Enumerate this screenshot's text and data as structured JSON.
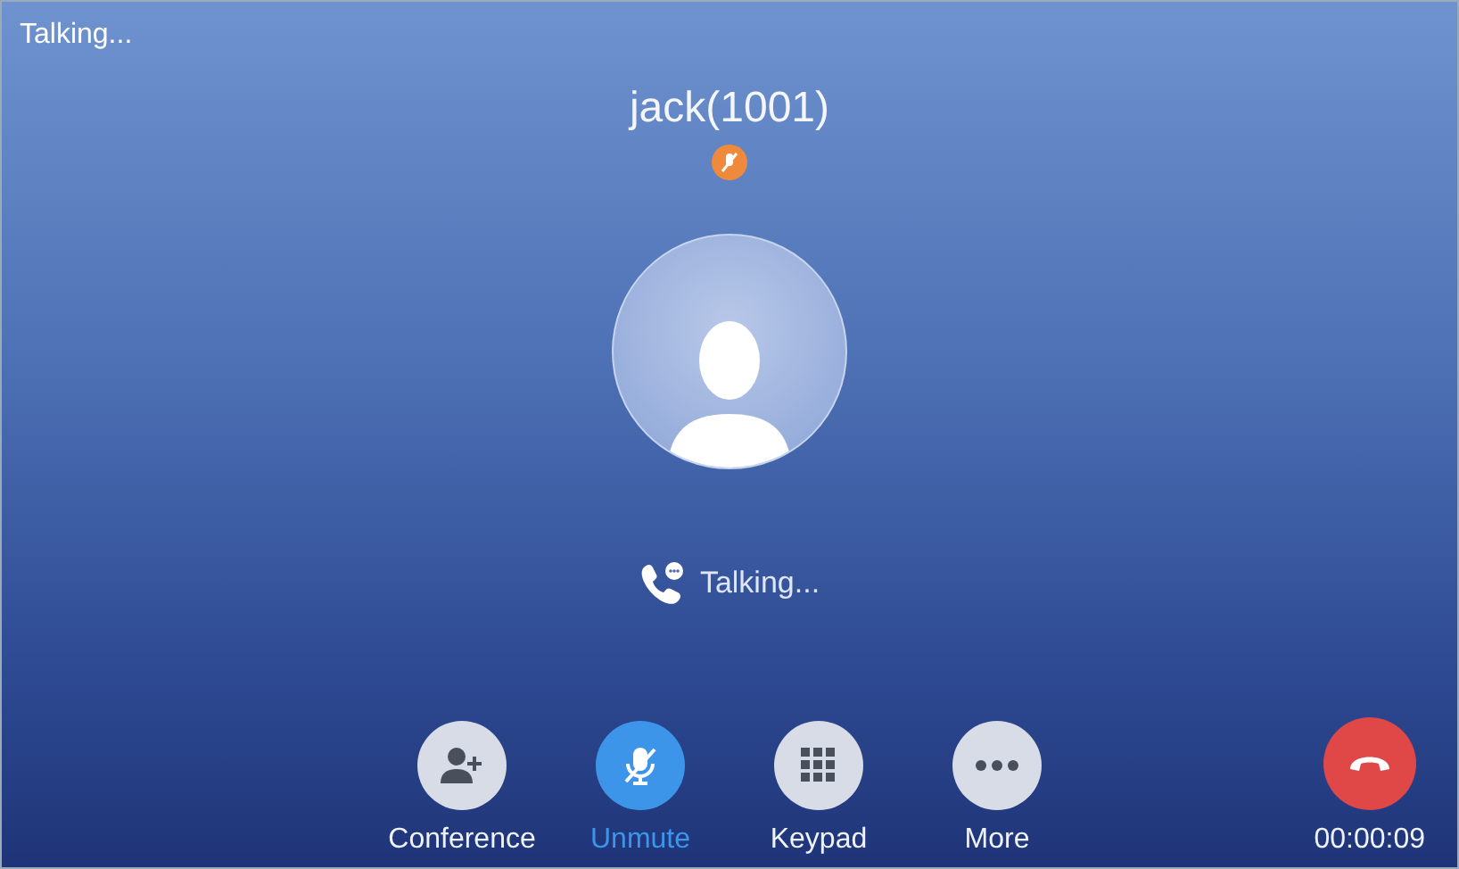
{
  "status_bar": {
    "text": "Talking..."
  },
  "caller": {
    "name": "jack(1001)"
  },
  "call_status": {
    "text": "Talking..."
  },
  "actions": [
    {
      "kind": "conference",
      "label": "Conference",
      "active": false
    },
    {
      "kind": "mute",
      "label": "Unmute",
      "active": true
    },
    {
      "kind": "keypad",
      "label": "Keypad",
      "active": false
    },
    {
      "kind": "more",
      "label": "More",
      "active": false
    }
  ],
  "hangup": {
    "timer": "00:00:09"
  }
}
